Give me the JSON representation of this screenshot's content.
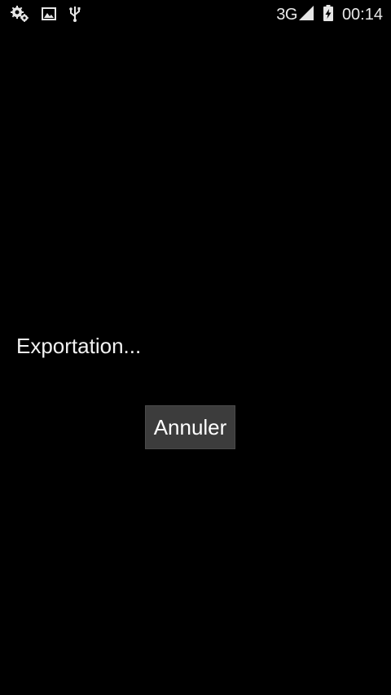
{
  "status_bar": {
    "left_icons": [
      "settings-gear-icon",
      "image-icon",
      "usb-icon"
    ],
    "network_type": "3G",
    "signal_icon": "signal-strength-icon",
    "battery_icon": "battery-charging-icon",
    "time": "00:14"
  },
  "dialog": {
    "message": "Exportation...",
    "cancel_label": "Annuler"
  },
  "colors": {
    "background": "#000000",
    "button_background": "#3c3c3c",
    "text": "#ffffff"
  }
}
